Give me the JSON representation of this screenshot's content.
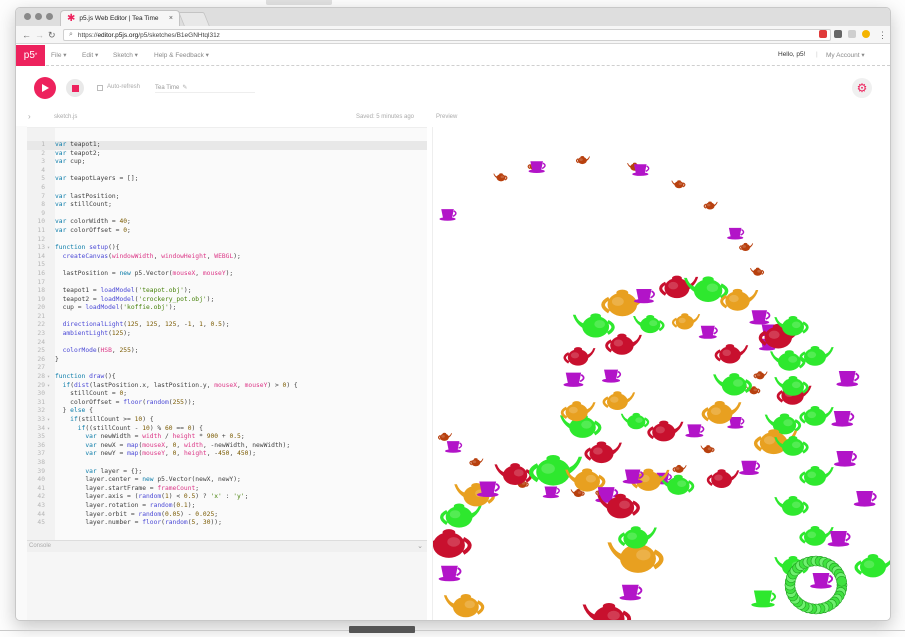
{
  "browser": {
    "tab_title": "p5.js Web Editor | Tea Time",
    "url_prefix": "https://",
    "url_host": "editor.p5js.org",
    "url_path": "/p5/sketches/B1eGNHtql31z"
  },
  "menu": {
    "logo": "p5",
    "logo_sup": "*",
    "items": [
      "File",
      "Edit",
      "Sketch",
      "Help & Feedback"
    ],
    "greeting": "Hello, p5!",
    "account": "My Account"
  },
  "toolbar": {
    "auto_refresh": "Auto-refresh",
    "project_name": "Tea Time"
  },
  "editor": {
    "file_name": "sketch.js",
    "saved_status": "Saved: 5 minutes ago",
    "preview_label": "Preview",
    "console_label": "Console",
    "code": [
      "var teapot1;",
      "var teapot2;",
      "var cup;",
      "",
      "var teapotLayers = [];",
      "",
      "var lastPosition;",
      "var stillCount;",
      "",
      "var colorWidth = 40;",
      "var colorOffset = 0;",
      "",
      "function setup(){",
      "  createCanvas(windowWidth, windowHeight, WEBGL);",
      "",
      "  lastPosition = new p5.Vector(mouseX, mouseY);",
      "",
      "  teapot1 = loadModel('teapot.obj');",
      "  teapot2 = loadModel('crockery_pot.obj');",
      "  cup = loadModel('koffie.obj');",
      "",
      "  directionalLight(125, 125, 125, -1, 1, 0.5);",
      "  ambientLight(125);",
      "",
      "  colorMode(HSB, 255);",
      "}",
      "",
      "function draw(){",
      "  if(dist(lastPosition.x, lastPosition.y, mouseX, mouseY) > 0) {",
      "    stillCount = 0;",
      "    colorOffset = floor(random(255));",
      "  } else {",
      "    if(stillCount >= 10) {",
      "      if((stillCount - 10) % 60 == 0) {",
      "        var newWidth = width / height * 900 + 0.5;",
      "        var newX = map(mouseX, 0, width, -newWidth, newWidth);",
      "        var newY = map(mouseY, 0, height, -450, 450);",
      "",
      "        var layer = {};",
      "        layer.center = new p5.Vector(newX, newY);",
      "        layer.startFrame = frameCount;",
      "        layer.axis = (random(1) < 0.5) ? 'x' : 'y';",
      "        layer.rotation = random(0.1);",
      "        layer.orbit = random(0.05) - 0.025;",
      "        layer.number = floor(random(5, 30));"
    ]
  },
  "icons": {
    "play": "play-icon",
    "stop": "stop-icon",
    "settings": "gear-icon"
  },
  "colors": {
    "accent": "#ed225d",
    "teapot_red": "#c8102e",
    "teapot_green": "#2ee82e",
    "teapot_orange": "#e8a020",
    "cup_magenta": "#b214c8"
  }
}
